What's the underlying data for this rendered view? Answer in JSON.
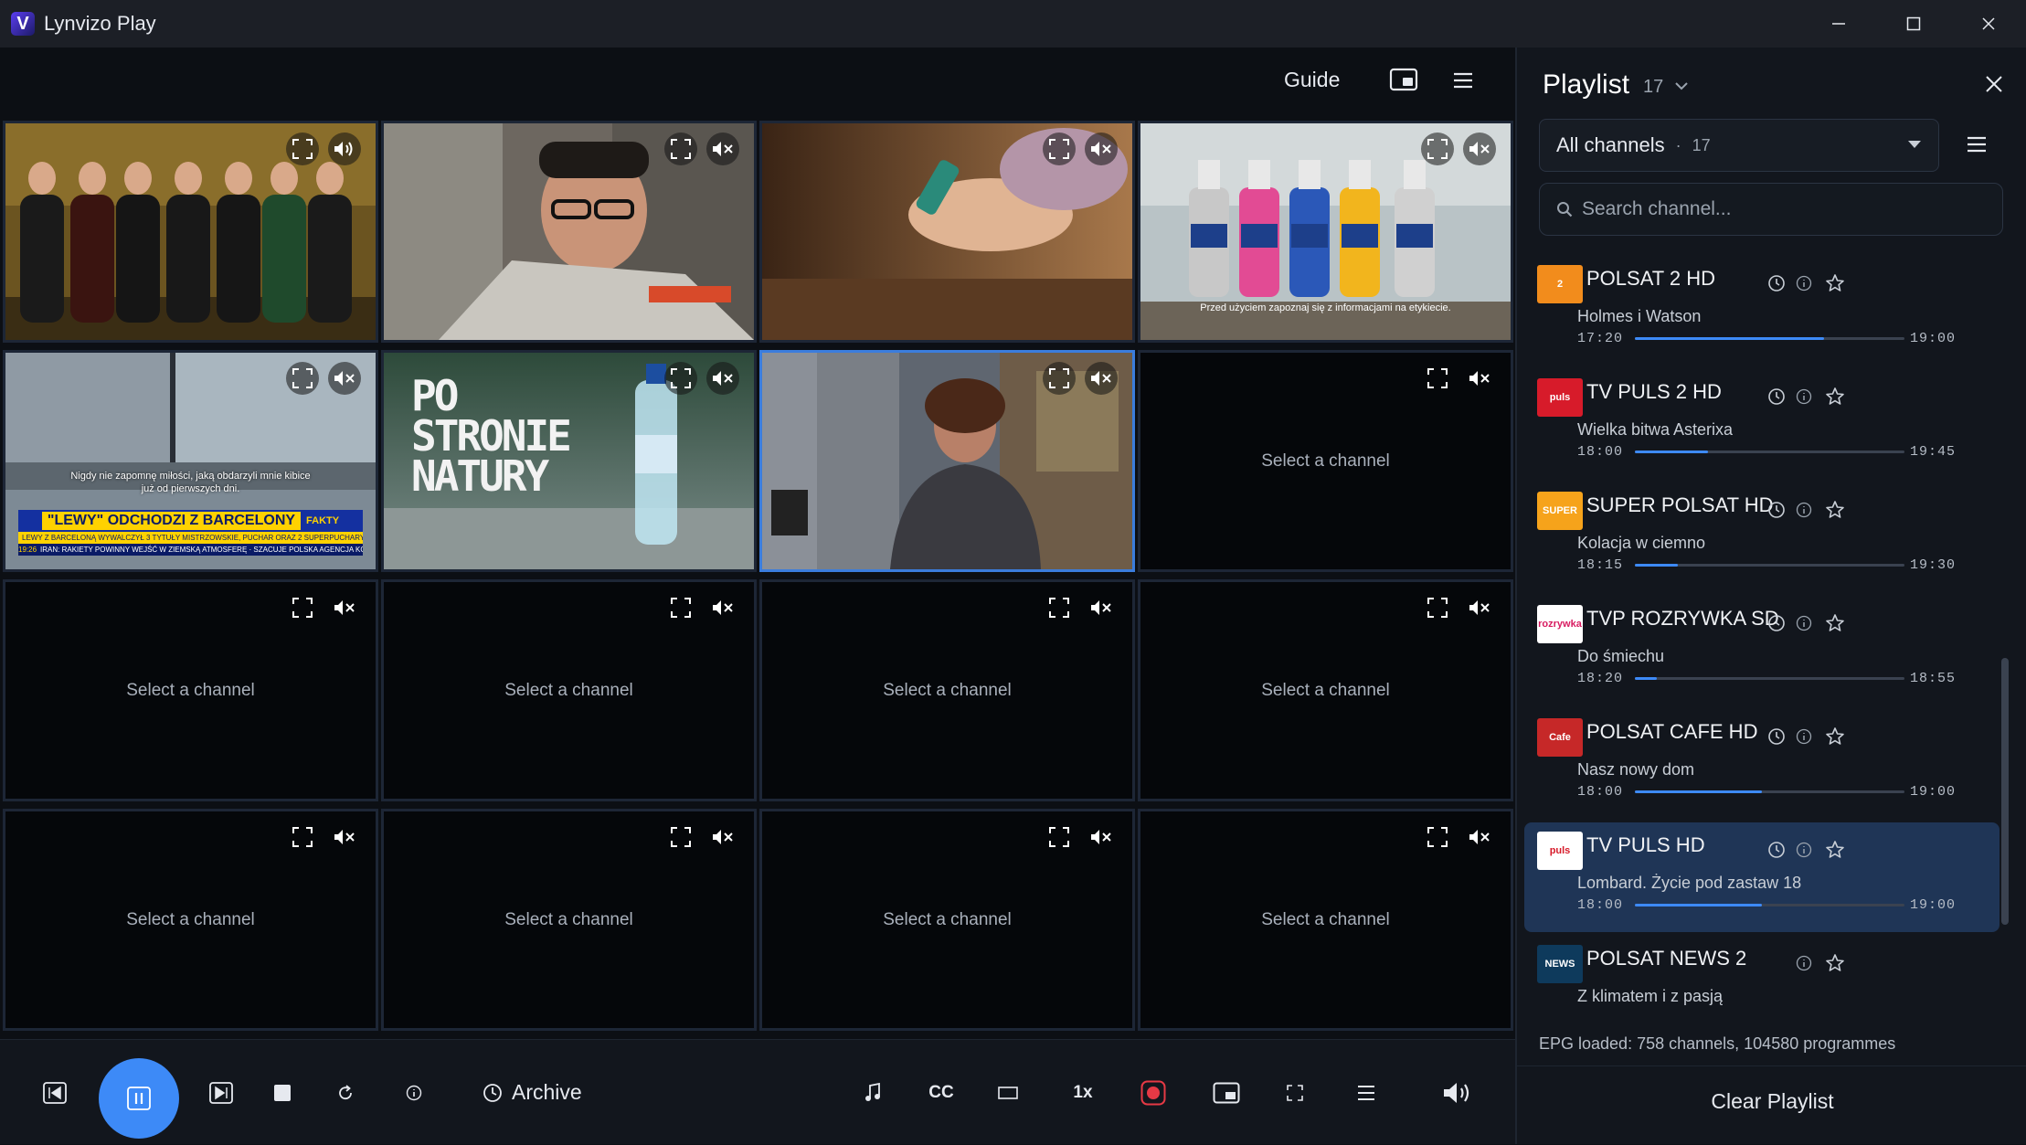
{
  "app": {
    "title": "Lynvizo Play",
    "logo_letter": "V"
  },
  "topbar": {
    "guide_label": "Guide"
  },
  "grid": {
    "placeholder": "Select a channel",
    "cells": [
      {
        "type": "video",
        "scene": "band"
      },
      {
        "type": "video",
        "scene": "man"
      },
      {
        "type": "video",
        "scene": "feet"
      },
      {
        "type": "video",
        "scene": "domestos",
        "caption_line1": "Przed użyciem zapoznaj się z informacjami na etykiecie."
      },
      {
        "type": "video",
        "scene": "news",
        "subtitle_line1": "Nigdy nie zapomnę miłości, jaką obdarzyli mnie kibice",
        "subtitle_line2": "już od pierwszych dni.",
        "headline": "\"LEWY\" ODCHODZI Z BARCELONY",
        "ticker": "LEWY Z BARCELONĄ WYWALCZYŁ 3 TYTUŁY MISTRZOWSKIE, PUCHAR ORAZ 2 SUPERPUCHARY",
        "brand": "FAKTY",
        "time": "19:26",
        "ticker2": "IRAN: RAKIETY POWINNY WEJŚĆ W ZIEMSKĄ ATMOSFERĘ · SZACUJE POLSKA AGENCJA KOSMICZNA"
      },
      {
        "type": "video",
        "scene": "water",
        "ad_text": "PO STRONIE NATURY"
      },
      {
        "type": "video",
        "scene": "woman",
        "selected": true
      },
      {
        "type": "empty"
      },
      {
        "type": "empty"
      },
      {
        "type": "empty"
      },
      {
        "type": "empty"
      },
      {
        "type": "empty"
      },
      {
        "type": "empty"
      },
      {
        "type": "empty"
      },
      {
        "type": "empty"
      },
      {
        "type": "empty"
      }
    ]
  },
  "controls": {
    "archive_label": "Archive",
    "speed_label": "1x",
    "cc_label": "CC"
  },
  "playlist": {
    "title": "Playlist",
    "count": "17",
    "filter": {
      "label": "All channels",
      "count": "17"
    },
    "search_placeholder": "Search channel...",
    "channels": [
      {
        "name": "POLSAT 2 HD",
        "programme": "Holmes i Watson",
        "start": "17:20",
        "end": "19:00",
        "progress": 0.7,
        "logo_bg": "#f28c1c",
        "logo_text": "2",
        "logo_color": "#ffffff",
        "archive": true
      },
      {
        "name": "TV PULS 2 HD",
        "programme": "Wielka bitwa Asterixa",
        "start": "18:00",
        "end": "19:45",
        "progress": 0.27,
        "logo_bg": "#d71b2a",
        "logo_text": "puls",
        "logo_color": "#ffffff",
        "archive": true
      },
      {
        "name": "SUPER POLSAT HD",
        "programme": "Kolacja w ciemno",
        "start": "18:15",
        "end": "19:30",
        "progress": 0.16,
        "logo_bg": "#f6a31b",
        "logo_text": "SUPER",
        "logo_color": "#ffffff",
        "archive": true
      },
      {
        "name": "TVP ROZRYWKA SD",
        "programme": "Do śmiechu",
        "start": "18:20",
        "end": "18:55",
        "progress": 0.08,
        "logo_bg": "#ffffff",
        "logo_text": "rozrywka",
        "logo_color": "#d81b60",
        "archive": true
      },
      {
        "name": "POLSAT CAFE HD",
        "programme": "Nasz nowy dom",
        "start": "18:00",
        "end": "19:00",
        "progress": 0.47,
        "logo_bg": "#c62828",
        "logo_text": "Cafe",
        "logo_color": "#ffffff",
        "archive": true
      },
      {
        "name": "TV PULS HD",
        "programme": "Lombard. Życie pod zastaw 18",
        "start": "18:00",
        "end": "19:00",
        "progress": 0.47,
        "logo_bg": "#ffffff",
        "logo_text": "puls",
        "logo_color": "#d71b2a",
        "archive": true,
        "active": true
      },
      {
        "name": "POLSAT NEWS 2",
        "programme": "Z klimatem i z pasją",
        "start": "",
        "end": "",
        "progress": 0,
        "logo_bg": "#0e3a5c",
        "logo_text": "NEWS",
        "logo_color": "#ffffff",
        "archive": false
      }
    ],
    "epg_status": "EPG loaded: 758 channels, 104580 programmes",
    "clear_label": "Clear Playlist"
  },
  "colors": {
    "accent": "#3d8af7",
    "record": "#e53945",
    "selected_border": "#3b7ddd"
  }
}
